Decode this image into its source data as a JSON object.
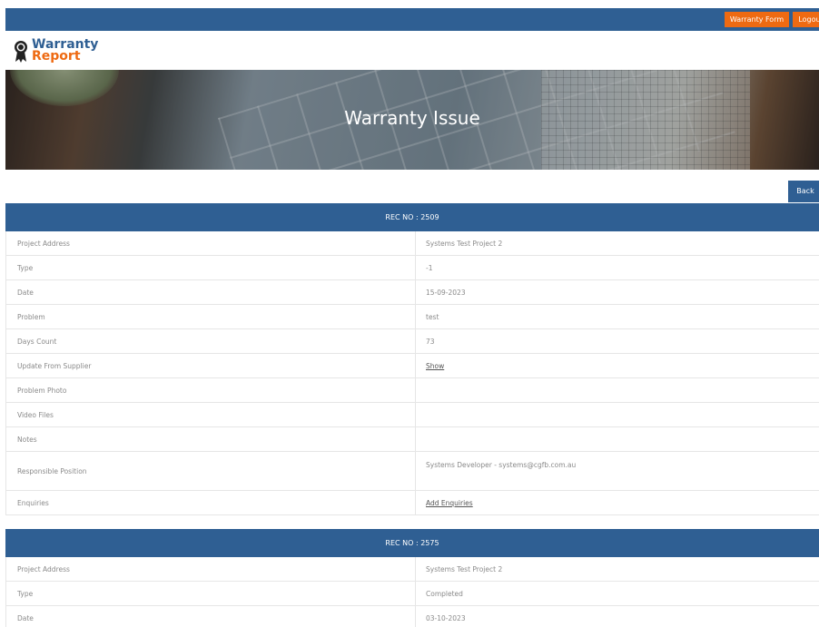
{
  "nav": {
    "warranty_form": "Warranty Form",
    "logout": "Logout"
  },
  "logo": {
    "line1": "Warranty",
    "line2": "Report"
  },
  "banner": {
    "title": "Warranty Issue"
  },
  "back_label": "Back",
  "records": [
    {
      "header": "REC NO : 2509",
      "rows": [
        {
          "label": "Project Address",
          "value": "Systems Test Project 2"
        },
        {
          "label": "Type",
          "value": "-1"
        },
        {
          "label": "Date",
          "value": "15-09-2023"
        },
        {
          "label": "Problem",
          "value": "test"
        },
        {
          "label": "Days Count",
          "value": "73"
        },
        {
          "label": "Update From Supplier",
          "value": "Show"
        },
        {
          "label": "Problem Photo",
          "value": ""
        },
        {
          "label": "Video Files",
          "value": ""
        },
        {
          "label": "Notes",
          "value": ""
        },
        {
          "label": "Responsible Position",
          "value": "Systems Developer - systems@cgfb.com.au"
        },
        {
          "label": "Enquiries",
          "value": "Add Enquiries"
        }
      ]
    },
    {
      "header": "REC NO : 2575",
      "rows": [
        {
          "label": "Project Address",
          "value": "Systems Test Project 2"
        },
        {
          "label": "Type",
          "value": "Completed"
        },
        {
          "label": "Date",
          "value": "03-10-2023"
        }
      ]
    }
  ],
  "colors": {
    "primary": "#2f5f93",
    "accent": "#ee6a12"
  }
}
